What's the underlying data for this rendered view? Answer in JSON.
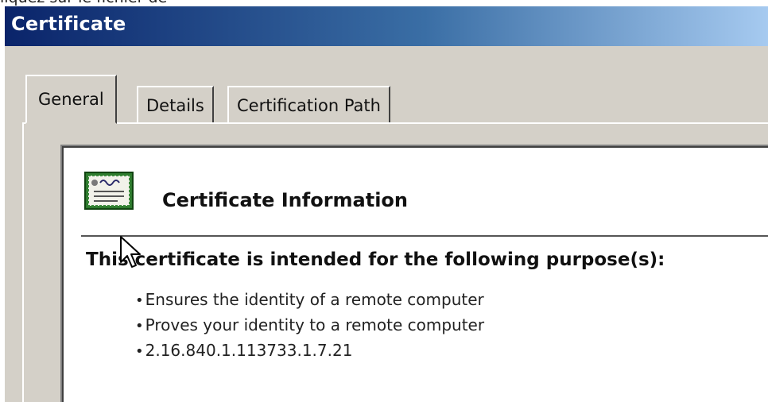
{
  "context_text": "liquez sur le fichier de",
  "window": {
    "title": "Certificate"
  },
  "tabs": [
    {
      "label": "General",
      "active": true
    },
    {
      "label": "Details",
      "active": false
    },
    {
      "label": "Certification Path",
      "active": false
    }
  ],
  "general": {
    "icon": "certificate-icon",
    "heading": "Certificate Information",
    "purpose_title": "This certificate is intended for the following purpose(s):",
    "purposes": [
      "Ensures the identity of a remote computer",
      "Proves your identity to a remote computer",
      "2.16.840.1.113733.1.7.21"
    ]
  },
  "colors": {
    "titlebar_start": "#0a246a",
    "titlebar_end": "#a6caf0",
    "dialog_bg": "#d4d0c8"
  }
}
